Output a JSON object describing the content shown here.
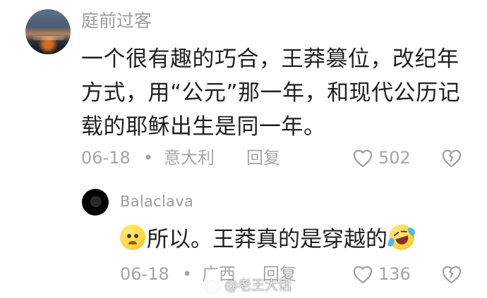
{
  "main_comment": {
    "username": "庭前过客",
    "text": "一个很有趣的巧合，王莽篡位，改纪年方式，用“公元”那一年，和现代公历记载的耶稣出生是同一年。",
    "date": "06-18",
    "separator": "•",
    "location": "意大利",
    "reply_label": "回复",
    "likes": "502"
  },
  "reply_comment": {
    "username": "Balaclava",
    "text": "所以。王莽真的是穿越的",
    "date": "06-18",
    "separator": "•",
    "location": "广西",
    "reply_label": "回复",
    "likes": "136"
  },
  "icons": {
    "like": "heart-outline-icon",
    "dislike": "broken-heart-icon",
    "emoji_1": "worried-face-emoji",
    "emoji_2": "rolling-laughing-emoji",
    "watermark_logo": "weibo-logo"
  },
  "watermark": {
    "text": "@老王大话"
  },
  "colors": {
    "text_primary": "#1f1f1f",
    "text_secondary": "#a5a5a5",
    "icon_gray": "#9e9e9e",
    "background": "#ffffff"
  }
}
